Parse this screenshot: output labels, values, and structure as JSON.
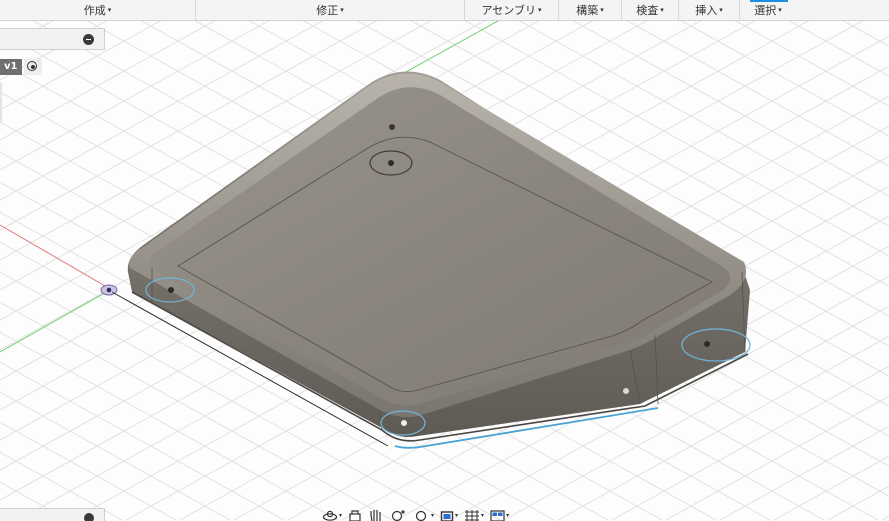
{
  "toolbar": {
    "items": [
      {
        "label": "作成"
      },
      {
        "label": "修正"
      },
      {
        "label": "アセンブリ"
      },
      {
        "label": "構築"
      },
      {
        "label": "検査"
      },
      {
        "label": "挿入"
      },
      {
        "label": "選択"
      }
    ],
    "caret": "▾"
  },
  "browser": {
    "version_label": "v1"
  },
  "colors": {
    "accent": "#1d8fe1",
    "part_top": "#8d877e",
    "part_side": "#6e6962",
    "selected_edge": "#4aa3d4",
    "x_axis": "#e06060",
    "y_axis": "#5ac85a"
  },
  "navigation": {
    "icons": [
      "orbit-icon",
      "look-at-icon",
      "pan-icon",
      "zoom-icon",
      "fit-icon",
      "display-mode-icon",
      "grid-icon",
      "viewports-icon"
    ]
  }
}
